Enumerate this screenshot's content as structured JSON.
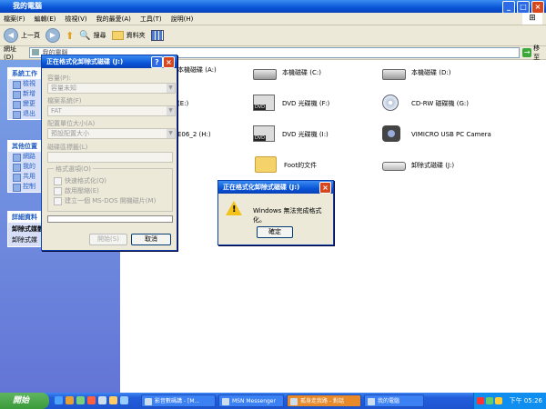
{
  "window": {
    "title": "我的電腦"
  },
  "menu": [
    "檔案(F)",
    "編輯(E)",
    "檢視(V)",
    "我的最愛(A)",
    "工具(T)",
    "說明(H)"
  ],
  "toolbar": {
    "back": "上一頁",
    "search": "搜尋",
    "folders": "資料夾"
  },
  "address": {
    "label": "網址(D)",
    "value": "我的電腦",
    "go": "移至"
  },
  "taskpane": {
    "system_head": "系統工作",
    "system_items": [
      "檢視",
      "新增",
      "變更",
      "退出"
    ],
    "other_head": "其他位置",
    "other_items": [
      "網路",
      "我的",
      "共用",
      "控制"
    ],
    "details_head": "詳細資料",
    "details_text": "卸除式媒體",
    "details_sub": "卸除式媒"
  },
  "drives": [
    {
      "label": "本機磁碟 (A:)",
      "icon": "hard-disk-icon"
    },
    {
      "label": "本機磁碟 (C:)",
      "icon": "hard-disk-icon"
    },
    {
      "label": "本機磁碟 (D:)",
      "icon": "hard-disk-icon"
    },
    {
      "label": "(E:)",
      "icon": "hard-disk-icon"
    },
    {
      "label": "DVD 光碟機 (F:)",
      "icon": "dvd-drive-icon"
    },
    {
      "label": "CD-RW 磁碟機 (G:)",
      "icon": "cd-drive-icon"
    },
    {
      "label": "E06_2 (H:)",
      "icon": "hard-disk-icon"
    },
    {
      "label": "DVD 光碟機 (I:)",
      "icon": "dvd-drive-icon"
    },
    {
      "label": "VIMICRO USB PC Camera",
      "icon": "camera-icon"
    },
    {
      "label": "Foot的文件",
      "icon": "folder-icon"
    },
    {
      "label": "卸除式磁碟 (J:)",
      "icon": "removable-disk-icon"
    }
  ],
  "format_dialog": {
    "title": "正在格式化卸除式磁碟 (J:)",
    "capacity_label": "容量(P):",
    "capacity_value": "容量未知",
    "fs_label": "檔案系統(F)",
    "fs_value": "FAT",
    "alloc_label": "配置單位大小(A)",
    "alloc_value": "預設配置大小",
    "volume_label": "磁碟區標籤(L)",
    "options_title": "格式選項(O)",
    "opt_quick": "快速格式化(Q)",
    "opt_compress": "啟用壓縮(E)",
    "opt_boot": "建立一個 MS-DOS 開機磁片(M)",
    "progress": 0,
    "start_btn": "開始(S)",
    "close_btn": "取消"
  },
  "error_dialog": {
    "title": "正在格式化卸除式磁碟 (J:)",
    "message": "Windows 無法完成格式化。",
    "ok": "確定"
  },
  "taskbar": {
    "start": "開始",
    "tasks": [
      "影音數碼講 - [M...",
      "MSN Messenger",
      "孤身走我路 - 對話",
      "我的電腦"
    ],
    "clock": "下午 05:26"
  },
  "colors": {
    "title_blue": "#0a55d8",
    "start_green": "#3a9a3a",
    "taskbar_blue": "#245edb"
  }
}
